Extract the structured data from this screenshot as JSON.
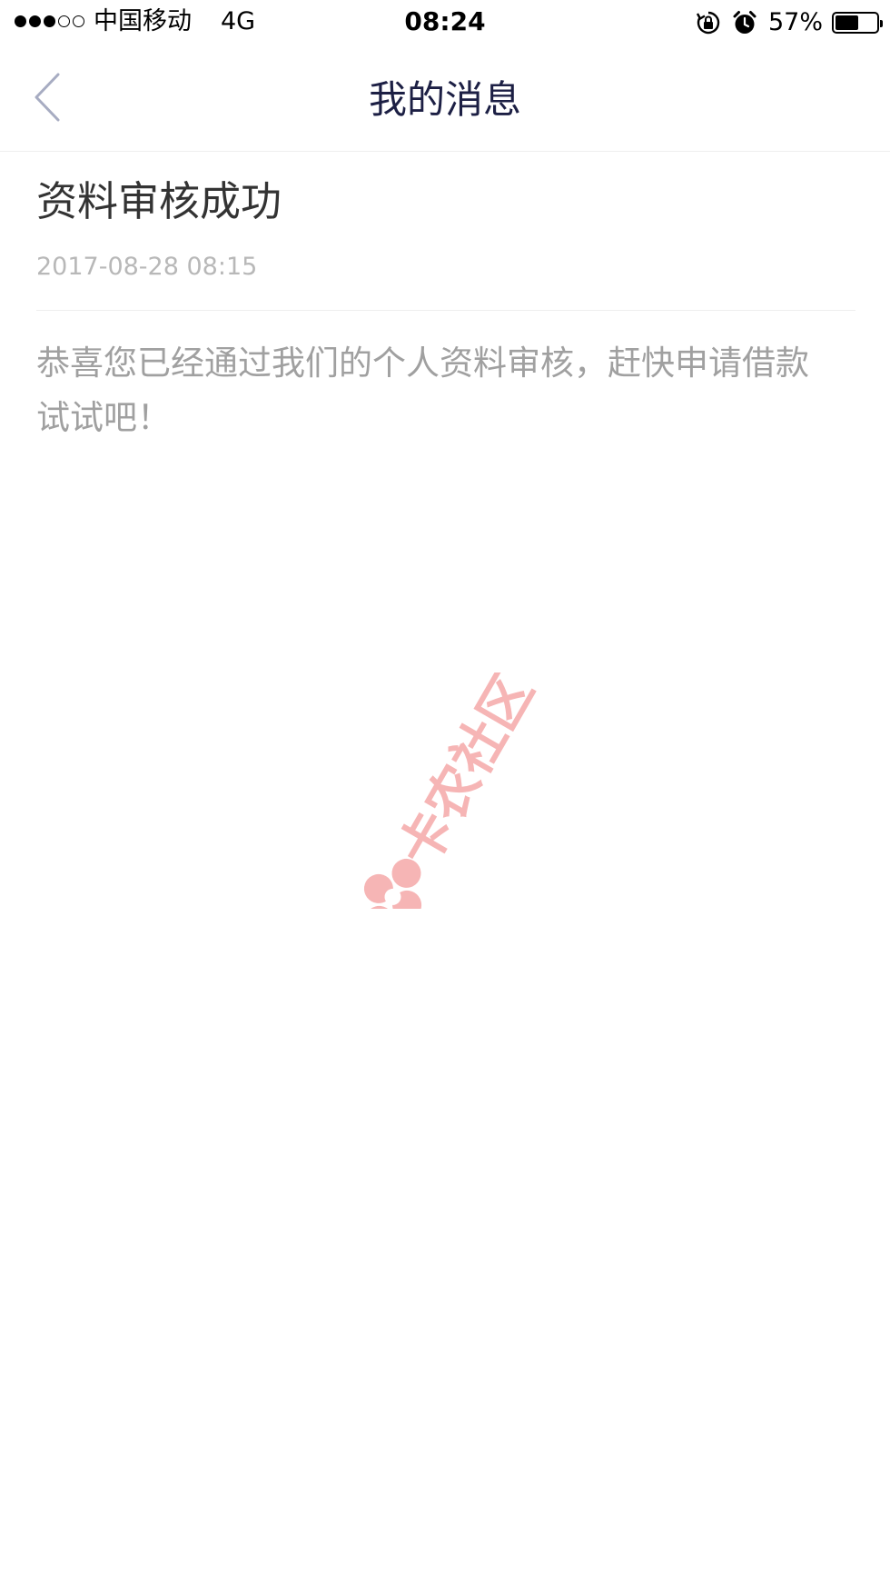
{
  "status_bar": {
    "signal_dots": [
      "on",
      "on",
      "on",
      "off",
      "off"
    ],
    "carrier": "中国移动",
    "network": "4G",
    "time": "08:24",
    "icons": [
      "rotation-lock-icon",
      "alarm-icon"
    ],
    "battery_percent": "57%",
    "battery_level": 0.57
  },
  "nav": {
    "back_icon": "chevron-left-icon",
    "title": "我的消息"
  },
  "message": {
    "title": "资料审核成功",
    "timestamp": "2017-08-28 08:15",
    "body": "恭喜您已经通过我们的个人资料审核，赶快申请借款试试吧！"
  },
  "watermark": {
    "text": "卡农社区",
    "color": "#f6b5b5"
  }
}
